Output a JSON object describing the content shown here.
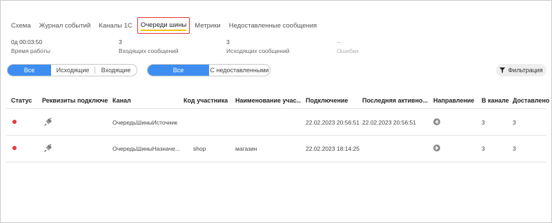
{
  "tabs": [
    {
      "label": "Схема"
    },
    {
      "label": "Журнал событий"
    },
    {
      "label": "Каналы 1С"
    },
    {
      "label": "Очереди шины",
      "active": true
    },
    {
      "label": "Метрики"
    },
    {
      "label": "Недоставленные сообщения"
    }
  ],
  "stats": {
    "uptime": {
      "value": "0д 00:03:50",
      "label": "Время работы"
    },
    "incoming": {
      "value": "3",
      "label": "Входящих сообщений"
    },
    "outgoing": {
      "value": "3",
      "label": "Исходящих сообщений"
    },
    "errors": {
      "value": "--",
      "label": "Ошибки"
    }
  },
  "direction_filter": {
    "all": "Все",
    "outgoing": "Исходящие",
    "incoming": "Входящие",
    "selected": "Все"
  },
  "delivery_filter": {
    "all": "Все",
    "undelivered": "С недоставленными",
    "selected": "Все"
  },
  "filter_button": {
    "label": "Фильтрация"
  },
  "table": {
    "headers": {
      "status": "Статус",
      "details": "Реквизиты подключе...",
      "channel": "Канал",
      "participant_code": "Код участника",
      "participant_name": "Наименование учас...",
      "connected": "Подключение",
      "last_activity": "Последняя активно...",
      "direction": "Направление",
      "in_channel": "В канале",
      "delivered": "Доставлено"
    },
    "rows": [
      {
        "status_color": "#e53935",
        "channel": "ОчередьШиныИсточник",
        "participant_code": "",
        "participant_name": "",
        "connected": "22.02.2023 20:56:51",
        "last_activity": "22.02.2023 20:56:51",
        "direction_icon": "arrow-left-icon",
        "in_channel": "3",
        "delivered": "3"
      },
      {
        "status_color": "#e53935",
        "channel": "ОчередьШиныНазначе...",
        "participant_code": "shop",
        "participant_name": "магазин",
        "connected": "22.02.2023 18:14:25",
        "last_activity": "",
        "direction_icon": "arrow-right-icon",
        "in_channel": "3",
        "delivered": "3"
      }
    ]
  },
  "colors": {
    "accent": "#3d8ef0",
    "status_error": "#e53935",
    "tab_highlight": "#e03030",
    "tab_underline": "#f2c200"
  }
}
